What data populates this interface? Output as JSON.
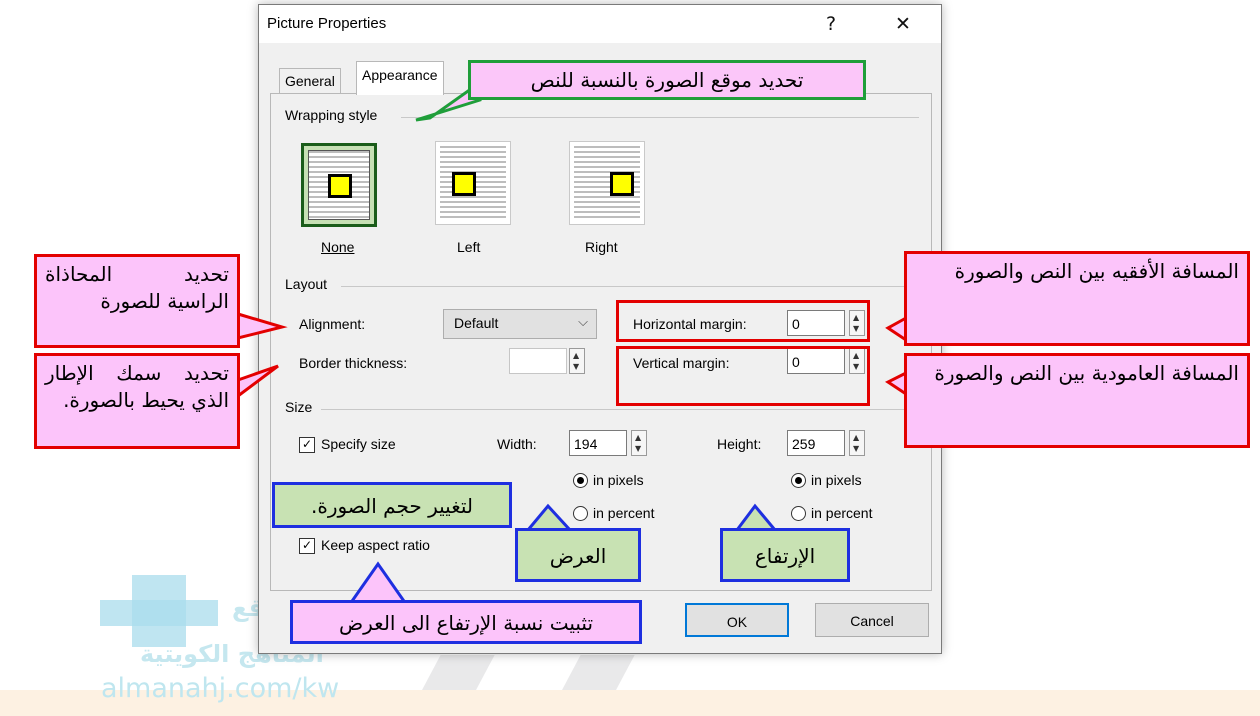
{
  "dialog": {
    "title": "Picture Properties",
    "help_glyph": "?",
    "close_glyph": "✕",
    "tabs": [
      {
        "label": "General",
        "active": false
      },
      {
        "label": "Appearance",
        "active": true
      }
    ],
    "wrapping": {
      "group_label": "Wrapping style",
      "options": [
        {
          "label": "None",
          "selected": true
        },
        {
          "label": "Left",
          "selected": false
        },
        {
          "label": "Right",
          "selected": false
        }
      ]
    },
    "layout": {
      "group_label": "Layout",
      "alignment_label": "Alignment:",
      "alignment_value": "Default",
      "border_label": "Border thickness:",
      "border_value": "",
      "hmargin_label": "Horizontal margin:",
      "hmargin_value": "0",
      "vmargin_label": "Vertical margin:",
      "vmargin_value": "0"
    },
    "size": {
      "group_label": "Size",
      "specify_label": "Specify size",
      "specify_checked": true,
      "width_label": "Width:",
      "width_value": "194",
      "height_label": "Height:",
      "height_value": "259",
      "in_pixels": "in pixels",
      "in_percent": "in percent",
      "keep_aspect_label": "Keep aspect ratio",
      "keep_aspect_checked": true
    },
    "buttons": {
      "ok": "OK",
      "cancel": "Cancel"
    }
  },
  "annotations": {
    "position_text": "تحديد موقع الصورة بالنسبة للنص",
    "alignment_text": "تحديد المحاذاة الراسية للصورة",
    "border_text": "تحديد سمك الإطار الذي يحيط بالصورة.",
    "hmargin_text": "المسافة الأفقيه بين النص والصورة",
    "vmargin_text": "المسافة العامودية بين النص والصورة",
    "resize_text": "لتغيير حجم الصورة.",
    "width_text": "العرض",
    "height_text": "الإرتفاع",
    "aspect_text": "تثبيت نسبة الإرتفاع الى العرض"
  },
  "watermark": {
    "site": "almanahj.com/kw",
    "logo_line1": "موقع",
    "logo_line2": "المناهج الكويتية"
  },
  "colors": {
    "callout_red_border": "#e30000",
    "callout_green_border": "#1f9e3a",
    "callout_blue_border": "#1e2fe0",
    "callout_pink_fill": "#fcc4fa",
    "callout_green_fill": "#c8e2b3",
    "default_button_border": "#0078d7"
  }
}
